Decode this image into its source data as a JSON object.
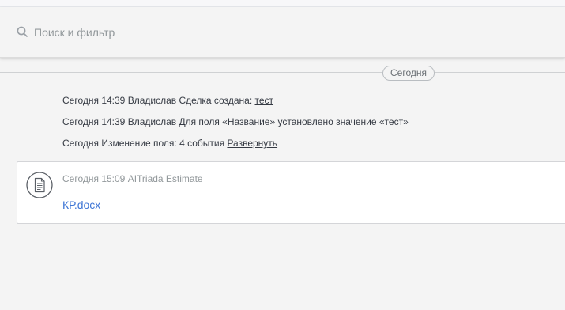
{
  "search": {
    "placeholder": "Поиск и фильтр",
    "icon": "search-icon"
  },
  "divider": {
    "label": "Сегодня"
  },
  "events": [
    {
      "prefix": "Сегодня 14:39 Владислав Сделка создана: ",
      "link": "тест"
    },
    {
      "text": "Сегодня 14:39 Владислав Для поля «Название» установлено значение «тест»"
    },
    {
      "prefix": "Сегодня Изменение поля: 4 события ",
      "link": "Развернуть"
    }
  ],
  "note": {
    "icon": "document-icon",
    "header": "Сегодня 15:09 AITriada Estimate",
    "file_name": "КР.docx"
  },
  "colors": {
    "background": "#f4f4f4",
    "link_blue": "#4077d6",
    "muted_text": "#92989b",
    "text": "#363b44"
  }
}
